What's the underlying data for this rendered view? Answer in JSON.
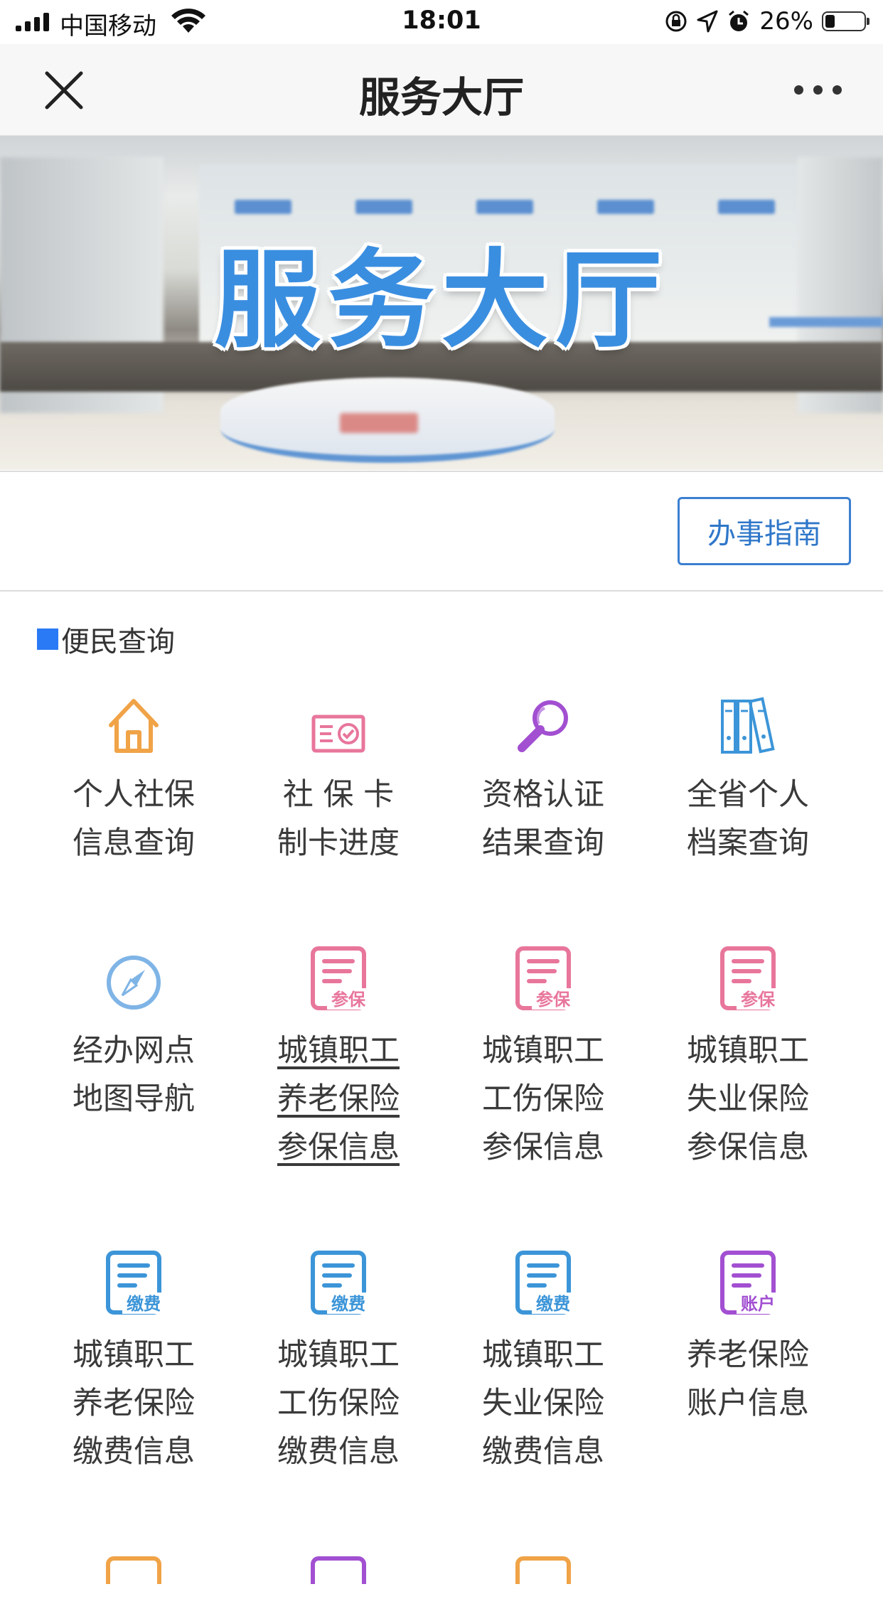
{
  "status_bar": {
    "carrier": "中国移动",
    "time": "18:01",
    "battery_pct": "26%"
  },
  "nav": {
    "title": "服务大厅"
  },
  "banner": {
    "logo_text": "服务大厅"
  },
  "guide_button": "办事指南",
  "section": {
    "title": "便民查询"
  },
  "colors": {
    "accent_blue": "#2a79f5",
    "orange": "#f0a347",
    "pink": "#e8769b",
    "purple": "#a24fd1",
    "blue_icon": "#3c95d8"
  },
  "tiles": [
    {
      "icon": "house-icon",
      "lines": [
        "个人社保",
        "信息查询"
      ]
    },
    {
      "icon": "id-card-icon",
      "lines": [
        "社 保 卡",
        "制卡进度"
      ]
    },
    {
      "icon": "magnifier-icon",
      "lines": [
        "资格认证",
        "结果查询"
      ]
    },
    {
      "icon": "binders-icon",
      "lines": [
        "全省个人",
        "档案查询"
      ]
    },
    {
      "icon": "compass-icon",
      "lines": [
        "经办网点",
        "地图导航"
      ]
    },
    {
      "icon": "document-enroll-icon",
      "badge": "参保",
      "lines": [
        "城镇职工",
        "养老保险",
        "参保信息"
      ]
    },
    {
      "icon": "document-enroll-icon",
      "badge": "参保",
      "lines": [
        "城镇职工",
        "工伤保险",
        "参保信息"
      ]
    },
    {
      "icon": "document-enroll-icon",
      "badge": "参保",
      "lines": [
        "城镇职工",
        "失业保险",
        "参保信息"
      ]
    },
    {
      "icon": "document-payment-icon",
      "badge": "缴费",
      "lines": [
        "城镇职工",
        "养老保险",
        "缴费信息"
      ]
    },
    {
      "icon": "document-payment-icon",
      "badge": "缴费",
      "lines": [
        "城镇职工",
        "工伤保险",
        "缴费信息"
      ]
    },
    {
      "icon": "document-payment-icon",
      "badge": "缴费",
      "lines": [
        "城镇职工",
        "失业保险",
        "缴费信息"
      ]
    },
    {
      "icon": "document-account-icon",
      "badge": "账户",
      "lines": [
        "养老保险",
        "账户信息"
      ]
    }
  ]
}
